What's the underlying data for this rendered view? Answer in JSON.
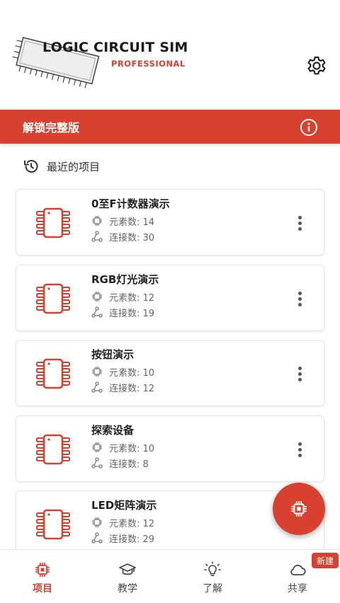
{
  "header": {
    "logo_title": "LOGIC CIRCUIT SIM",
    "logo_subtitle": "PROFESSIONAL",
    "settings_icon": "gear-icon"
  },
  "unlock_bar": {
    "label": "解锁完整版",
    "icon": "info-icon"
  },
  "recent": {
    "label": "最近的项目",
    "icon": "history-icon"
  },
  "projects": [
    {
      "title": "0至F计数器演示",
      "elements": "元素数: 14",
      "connections": "连接数: 30"
    },
    {
      "title": "RGB灯光演示",
      "elements": "元素数: 12",
      "connections": "连接数: 19"
    },
    {
      "title": "按钮演示",
      "elements": "元素数: 10",
      "connections": "连接数: 12"
    },
    {
      "title": "探索设备",
      "elements": "元素数: 10",
      "connections": "连接数: 8"
    },
    {
      "title": "LED矩阵演示",
      "elements": "元素数: 12",
      "connections": "连接数: 29"
    }
  ],
  "fab": {
    "icon": "chip-icon"
  },
  "bottom_nav": {
    "items": [
      {
        "label": "项目",
        "icon": "chip-icon",
        "active": true
      },
      {
        "label": "教学",
        "icon": "graduation-cap-icon",
        "active": false
      },
      {
        "label": "了解",
        "icon": "lightbulb-icon",
        "active": false
      },
      {
        "label": "共享",
        "icon": "cloud-icon",
        "active": false
      }
    ],
    "badge": "新建"
  },
  "colors": {
    "accent": "#d8412f",
    "text": "#333333",
    "muted": "#666666"
  }
}
